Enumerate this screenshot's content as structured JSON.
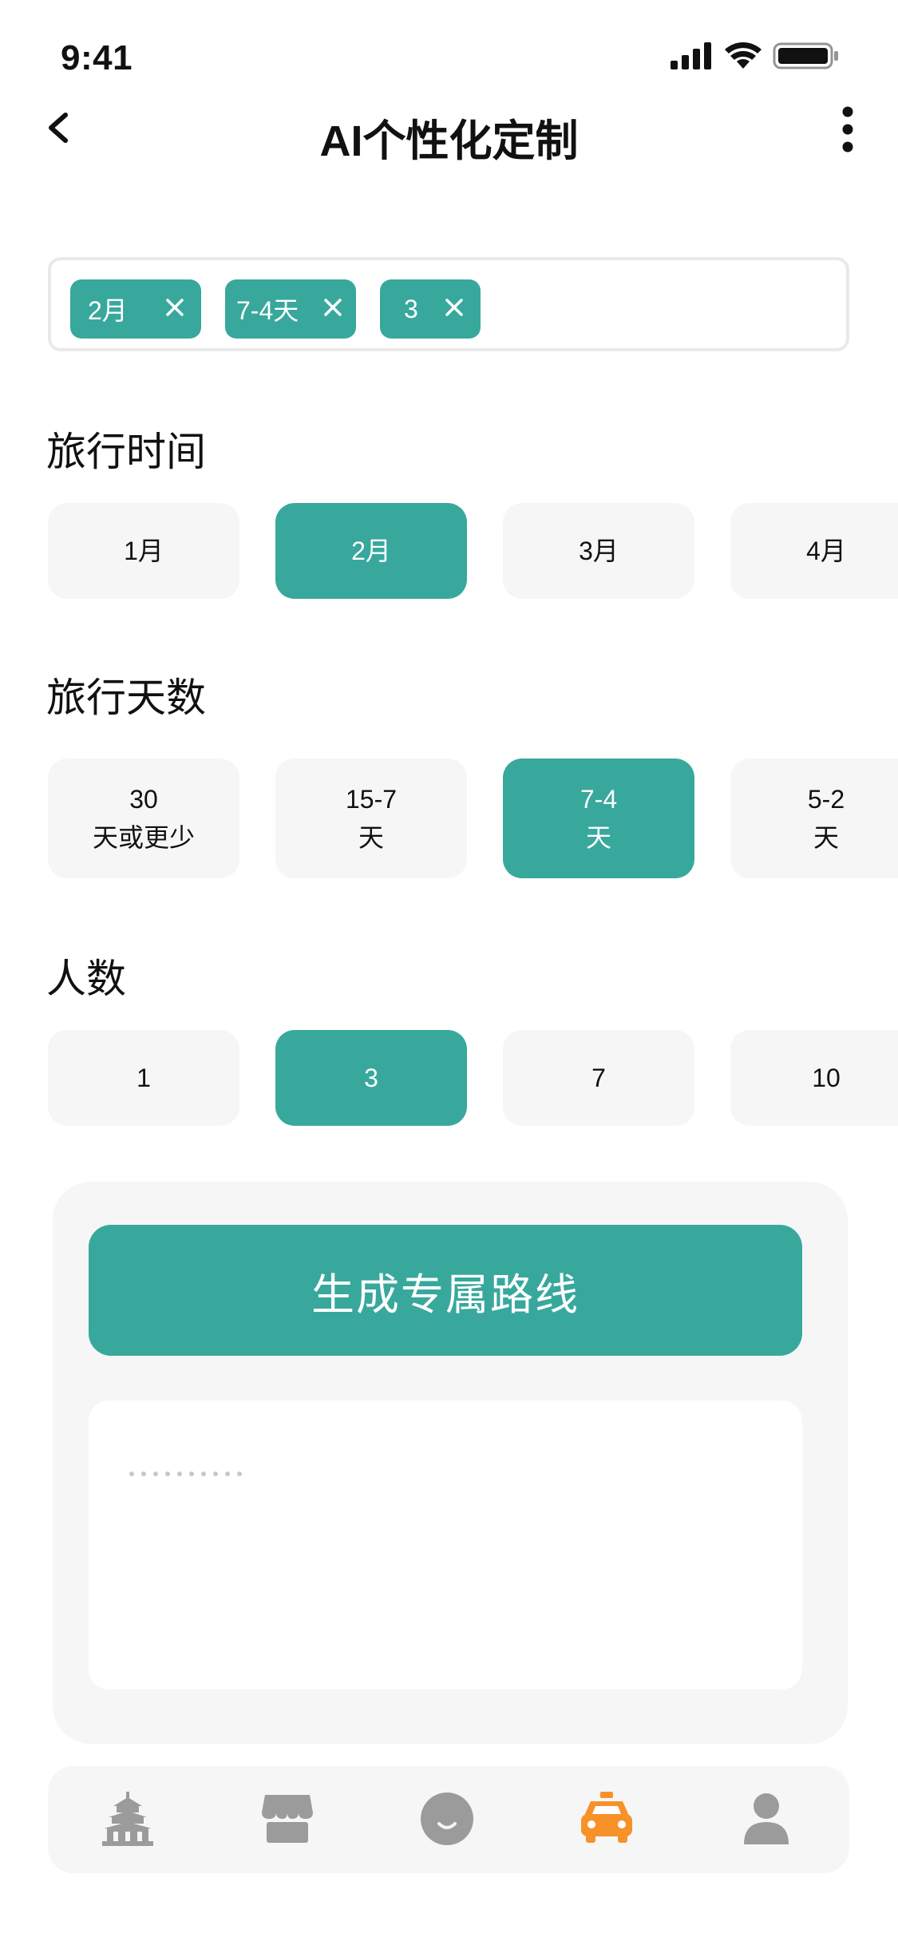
{
  "status_bar": {
    "time": "9:41"
  },
  "nav": {
    "title": "AI个性化定制"
  },
  "selected_tags": [
    {
      "label": "2月"
    },
    {
      "label": "7-4天"
    },
    {
      "label": "3"
    }
  ],
  "travel_time": {
    "title": "旅行时间",
    "options": [
      "1月",
      "2月",
      "3月",
      "4月"
    ],
    "selected": "2月"
  },
  "travel_days": {
    "title": "旅行天数",
    "options": [
      {
        "line1": "30",
        "line2": "天或更少"
      },
      {
        "line1": "15-7",
        "line2": "天"
      },
      {
        "line1": "7-4",
        "line2": "天"
      },
      {
        "line1": "5-2",
        "line2": "天"
      }
    ],
    "selected": "7-4"
  },
  "people": {
    "title": "人数",
    "options": [
      "1",
      "3",
      "7",
      "10"
    ],
    "selected": "3"
  },
  "generate": {
    "button_label": "生成专属路线"
  },
  "tab_bar": {
    "items": [
      {
        "icon": "temple-icon",
        "active": false
      },
      {
        "icon": "shop-icon",
        "active": false
      },
      {
        "icon": "smile-icon",
        "active": false
      },
      {
        "icon": "taxi-icon",
        "active": true
      },
      {
        "icon": "user-icon",
        "active": false
      }
    ]
  },
  "colors": {
    "accent": "#38a89d",
    "active_tab": "#f7922a",
    "inactive_tab": "#9b9b9b",
    "chip_bg": "#f6f6f6"
  }
}
